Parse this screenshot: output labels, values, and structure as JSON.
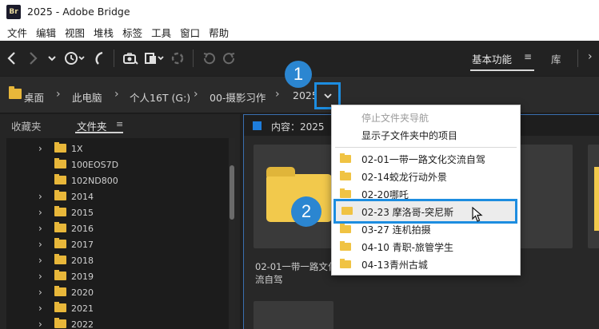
{
  "window": {
    "logo_text": "Br",
    "title": "2025 - Adobe Bridge"
  },
  "menubar": {
    "items": [
      "文件",
      "编辑",
      "视图",
      "堆栈",
      "标签",
      "工具",
      "窗口",
      "帮助"
    ]
  },
  "toolbar": {
    "icons": [
      "back-icon",
      "forward-icon",
      "chevron-down-icon",
      "recent-history-icon",
      "boomerang-icon",
      "camera-import-icon",
      "output-icon",
      "refine-icon",
      "rotate-left-icon",
      "rotate-right-icon"
    ],
    "workspace_label": "基本功能",
    "library_label": "库"
  },
  "path_bar": {
    "crumbs": [
      "桌面",
      "此电脑",
      "个人16T (G:)",
      "00-摄影习作",
      "2025"
    ]
  },
  "callouts": {
    "one": "1",
    "two": "2"
  },
  "left_panel": {
    "tabs": {
      "favorites": "收藏夹",
      "folders": "文件夹"
    },
    "tree": [
      {
        "label": "1X",
        "expandable": true
      },
      {
        "label": "100EOS7D",
        "expandable": false
      },
      {
        "label": "102ND800",
        "expandable": false
      },
      {
        "label": "2014",
        "expandable": true
      },
      {
        "label": "2015",
        "expandable": true
      },
      {
        "label": "2016",
        "expandable": true
      },
      {
        "label": "2017",
        "expandable": true
      },
      {
        "label": "2018",
        "expandable": true
      },
      {
        "label": "2019",
        "expandable": true
      },
      {
        "label": "2020",
        "expandable": true
      },
      {
        "label": "2021",
        "expandable": true
      },
      {
        "label": "2022",
        "expandable": true
      }
    ]
  },
  "content_panel": {
    "title": "内容：2025",
    "thumb_caption_line1": "02-01一带一路文化",
    "thumb_caption_line2": "流自驾"
  },
  "dropdown": {
    "stop_nav": "停止文件夹导航",
    "show_subfolders": "显示子文件夹中的项目",
    "folders": [
      "02-01一带一路文化交流自驾",
      "02-14蛟龙行动外景",
      "02-20哪吒",
      "02-23 摩洛哥-突尼斯",
      "03-27 连机拍摄",
      "04-10 青职-旅管学生",
      "04-13青州古城"
    ],
    "highlighted_index": 3
  },
  "colors": {
    "accent_blue": "#1d8de0",
    "callout_blue": "#2b86d1",
    "folder_yellow": "#f2c94c"
  }
}
